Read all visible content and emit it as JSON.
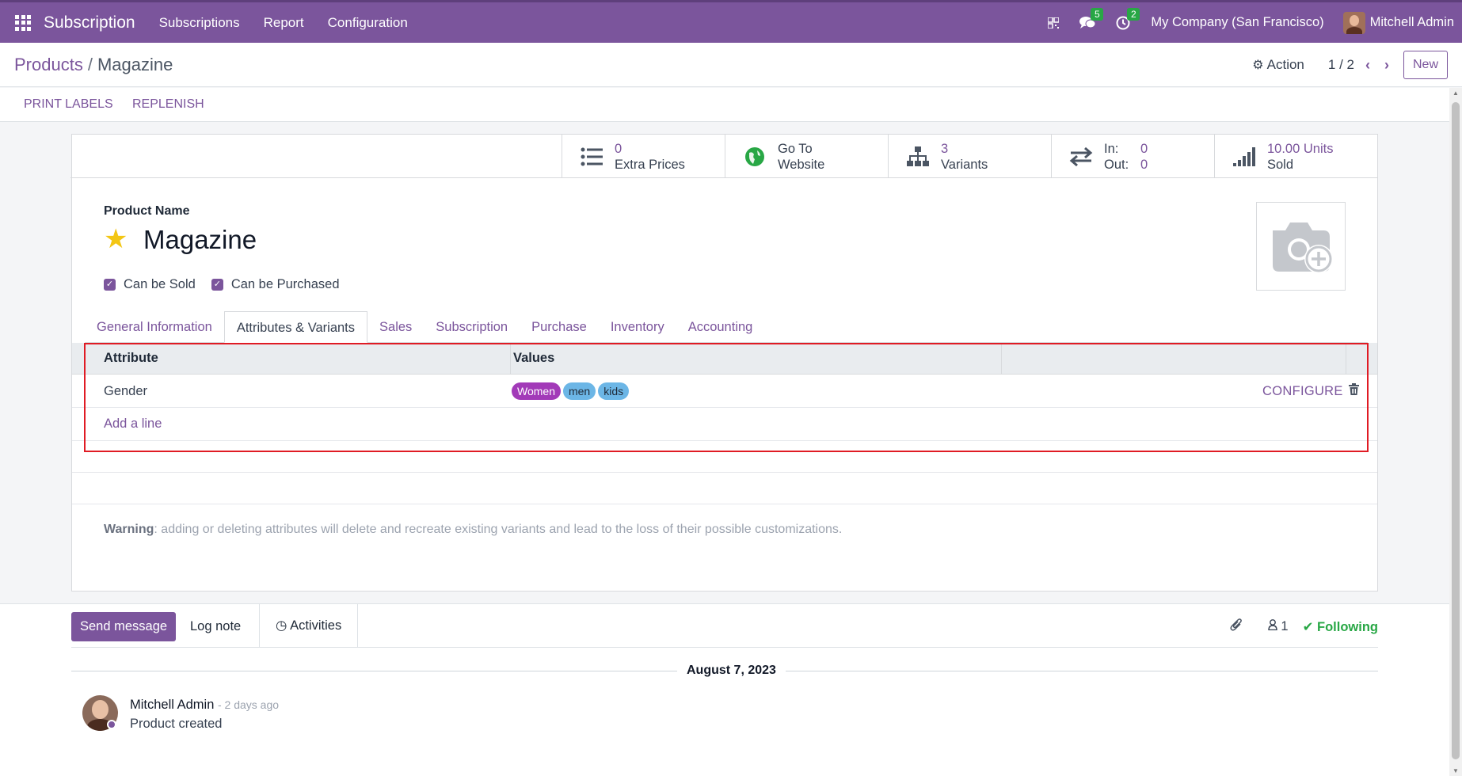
{
  "navbar": {
    "app_name": "Subscription",
    "menu": [
      "Subscriptions",
      "Report",
      "Configuration"
    ],
    "messages_badge": "5",
    "activities_badge": "2",
    "company": "My Company (San Francisco)",
    "user": "Mitchell Admin",
    "brand_color": "#7b559c"
  },
  "breadcrumb": {
    "parent": "Products",
    "separator": "/",
    "current": "Magazine"
  },
  "control": {
    "action_label": "Action",
    "pager": "1 / 2",
    "new_label": "New"
  },
  "statusbar": {
    "print_labels": "PRINT LABELS",
    "replenish": "REPLENISH"
  },
  "stats": {
    "extra_prices": {
      "value": "0",
      "label": "Extra Prices"
    },
    "website": {
      "line1": "Go To",
      "line2": "Website"
    },
    "variants": {
      "value": "3",
      "label": "Variants"
    },
    "inout": {
      "in_label": "In:",
      "in_value": "0",
      "out_label": "Out:",
      "out_value": "0"
    },
    "sold": {
      "value": "10.00 Units",
      "label": "Sold"
    }
  },
  "product": {
    "field_label": "Product Name",
    "name": "Magazine",
    "can_be_sold": "Can be Sold",
    "can_be_purchased": "Can be Purchased"
  },
  "tabs": [
    "General Information",
    "Attributes & Variants",
    "Sales",
    "Subscription",
    "Purchase",
    "Inventory",
    "Accounting"
  ],
  "attributes": {
    "headers": {
      "attribute": "Attribute",
      "values": "Values"
    },
    "rows": [
      {
        "attribute": "Gender",
        "values": [
          {
            "label": "Women",
            "color": "#a23ab8"
          },
          {
            "label": "men",
            "color": "#6cb6e6"
          },
          {
            "label": "kids",
            "color": "#6cb6e6"
          }
        ],
        "configure": "CONFIGURE"
      }
    ],
    "add_line": "Add a line"
  },
  "warning": {
    "label": "Warning",
    "text": ": adding or deleting attributes will delete and recreate existing variants and lead to the loss of their possible customizations."
  },
  "chatter": {
    "send_message": "Send message",
    "log_note": "Log note",
    "activities": "Activities",
    "followers_count": "1",
    "following": "Following",
    "date": "August 7, 2023",
    "message": {
      "author": "Mitchell Admin",
      "time": "- 2 days ago",
      "body": "Product created"
    }
  }
}
